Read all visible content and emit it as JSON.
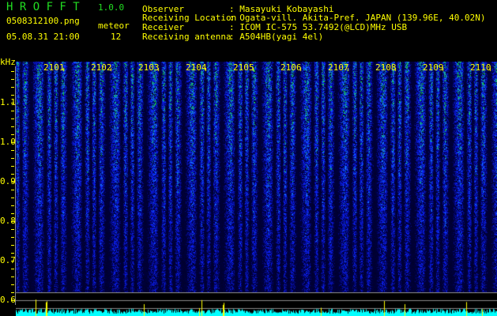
{
  "app": {
    "name": "H R O F F T",
    "version": "1.0.0"
  },
  "file": {
    "name": "0508312100.png",
    "datetime": "05.08.31 21:00"
  },
  "meteor": {
    "label": "meteor",
    "count": "12"
  },
  "info": [
    {
      "label": "Observer",
      "value": ": Masayuki Kobayashi"
    },
    {
      "label": "Receiving Location",
      "value": ": Ogata-vill. Akita-Pref. JAPAN (139.96E, 40.02N)"
    },
    {
      "label": "Receiver",
      "value": ": ICOM IC-575 53.7492(@LCD)MHz USB"
    },
    {
      "label": "Receiving antenna",
      "value": ": A504HB(yagi 4el)"
    }
  ],
  "chart_data": {
    "type": "heatmap",
    "ylabel": "kHz",
    "y_ticks": [
      "1.1",
      "1.0",
      "0.9",
      "0.8",
      "0.7",
      "0.6"
    ],
    "y_range_khz": [
      0.6,
      1.2
    ],
    "time_labels": [
      "2101",
      "2102",
      "2103",
      "2104",
      "2105",
      "2106",
      "2107",
      "2108",
      "2109",
      "2110"
    ],
    "colors": {
      "low": "#000020",
      "mid": "#1030ff",
      "high": "#20e060",
      "event": "#ffff00",
      "activity": "#00ffff"
    }
  }
}
